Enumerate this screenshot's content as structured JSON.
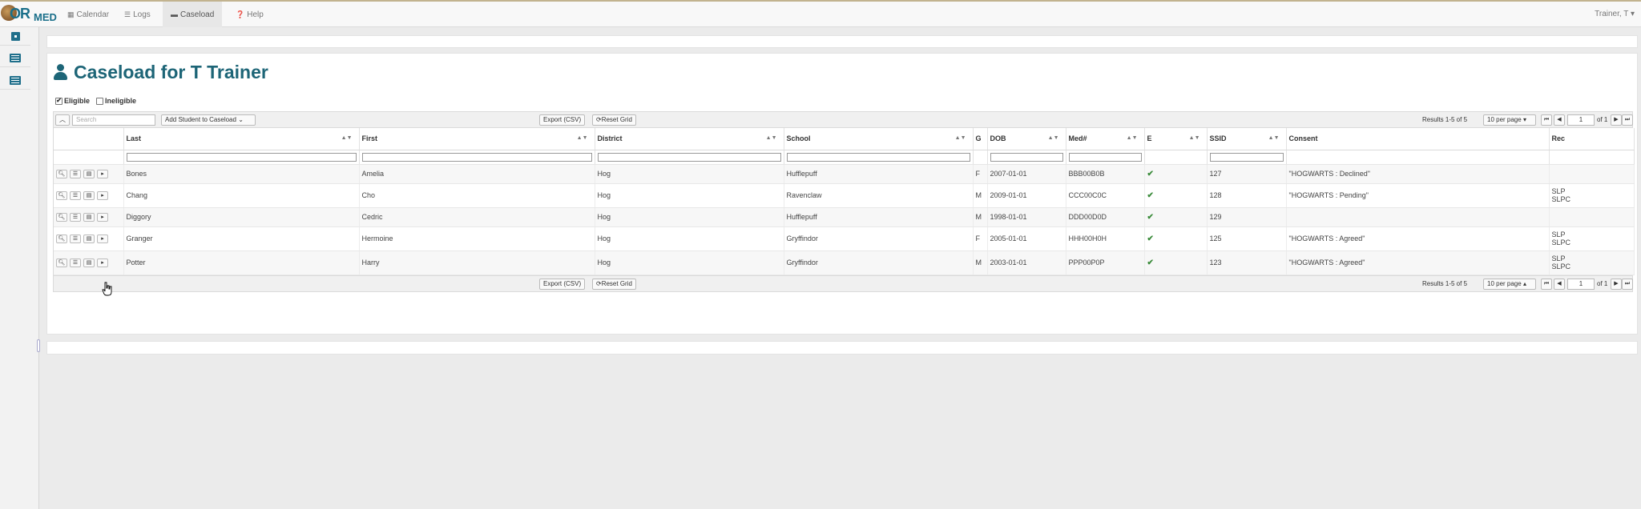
{
  "nav": {
    "logo_text": "OR",
    "logo_text2": "MED",
    "items": [
      {
        "label": "Calendar",
        "icon": "calendar-icon",
        "active": false
      },
      {
        "label": "Logs",
        "icon": "list-icon",
        "active": false
      },
      {
        "label": "Caseload",
        "icon": "briefcase-icon",
        "active": true
      },
      {
        "label": "Help",
        "icon": "question-icon",
        "active": false
      }
    ],
    "user": "Trainer, T"
  },
  "page": {
    "title": "Caseload for T Trainer"
  },
  "filters": {
    "eligible_label": "Eligible",
    "eligible_checked": true,
    "ineligible_label": "Ineligible",
    "ineligible_checked": false
  },
  "toolbar": {
    "search_placeholder": "Search",
    "add_student_label": "Add Student to Caseload",
    "export_label": "Export (CSV)",
    "reset_label": "Reset Grid",
    "results_text": "Results 1-5  of 5",
    "per_page_label": "10 per page",
    "page_value": "1",
    "page_of": "of 1"
  },
  "grid": {
    "columns": [
      "Last",
      "First",
      "District",
      "School",
      "G",
      "DOB",
      "Med#",
      "E",
      "SSID",
      "Consent",
      "Rec"
    ],
    "rows": [
      {
        "last": "Bones",
        "first": "Amelia",
        "district": "Hog",
        "school": "Hufflepuff",
        "g": "F",
        "dob": "2007-01-01",
        "med": "BBB00B0B",
        "e": "✔",
        "ssid": "127",
        "consent": "\"HOGWARTS : Declined\"",
        "rec1": "",
        "rec2": ""
      },
      {
        "last": "Chang",
        "first": "Cho",
        "district": "Hog",
        "school": "Ravenclaw",
        "g": "M",
        "dob": "2009-01-01",
        "med": "CCC00C0C",
        "e": "✔",
        "ssid": "128",
        "consent": "\"HOGWARTS : Pending\"",
        "rec1": "SLP",
        "rec2": "SLPC"
      },
      {
        "last": "Diggory",
        "first": "Cedric",
        "district": "Hog",
        "school": "Hufflepuff",
        "g": "M",
        "dob": "1998-01-01",
        "med": "DDD00D0D",
        "e": "✔",
        "ssid": "129",
        "consent": "",
        "rec1": "",
        "rec2": ""
      },
      {
        "last": "Granger",
        "first": "Hermoine",
        "district": "Hog",
        "school": "Gryffindor",
        "g": "F",
        "dob": "2005-01-01",
        "med": "HHH00H0H",
        "e": "✔",
        "ssid": "125",
        "consent": "\"HOGWARTS : Agreed\"",
        "rec1": "SLP",
        "rec2": "SLPC"
      },
      {
        "last": "Potter",
        "first": "Harry",
        "district": "Hog",
        "school": "Gryffindor",
        "g": "M",
        "dob": "2003-01-01",
        "med": "PPP00P0P",
        "e": "✔",
        "ssid": "123",
        "consent": "\"HOGWARTS : Agreed\"",
        "rec1": "SLP",
        "rec2": "SLPC"
      }
    ]
  }
}
